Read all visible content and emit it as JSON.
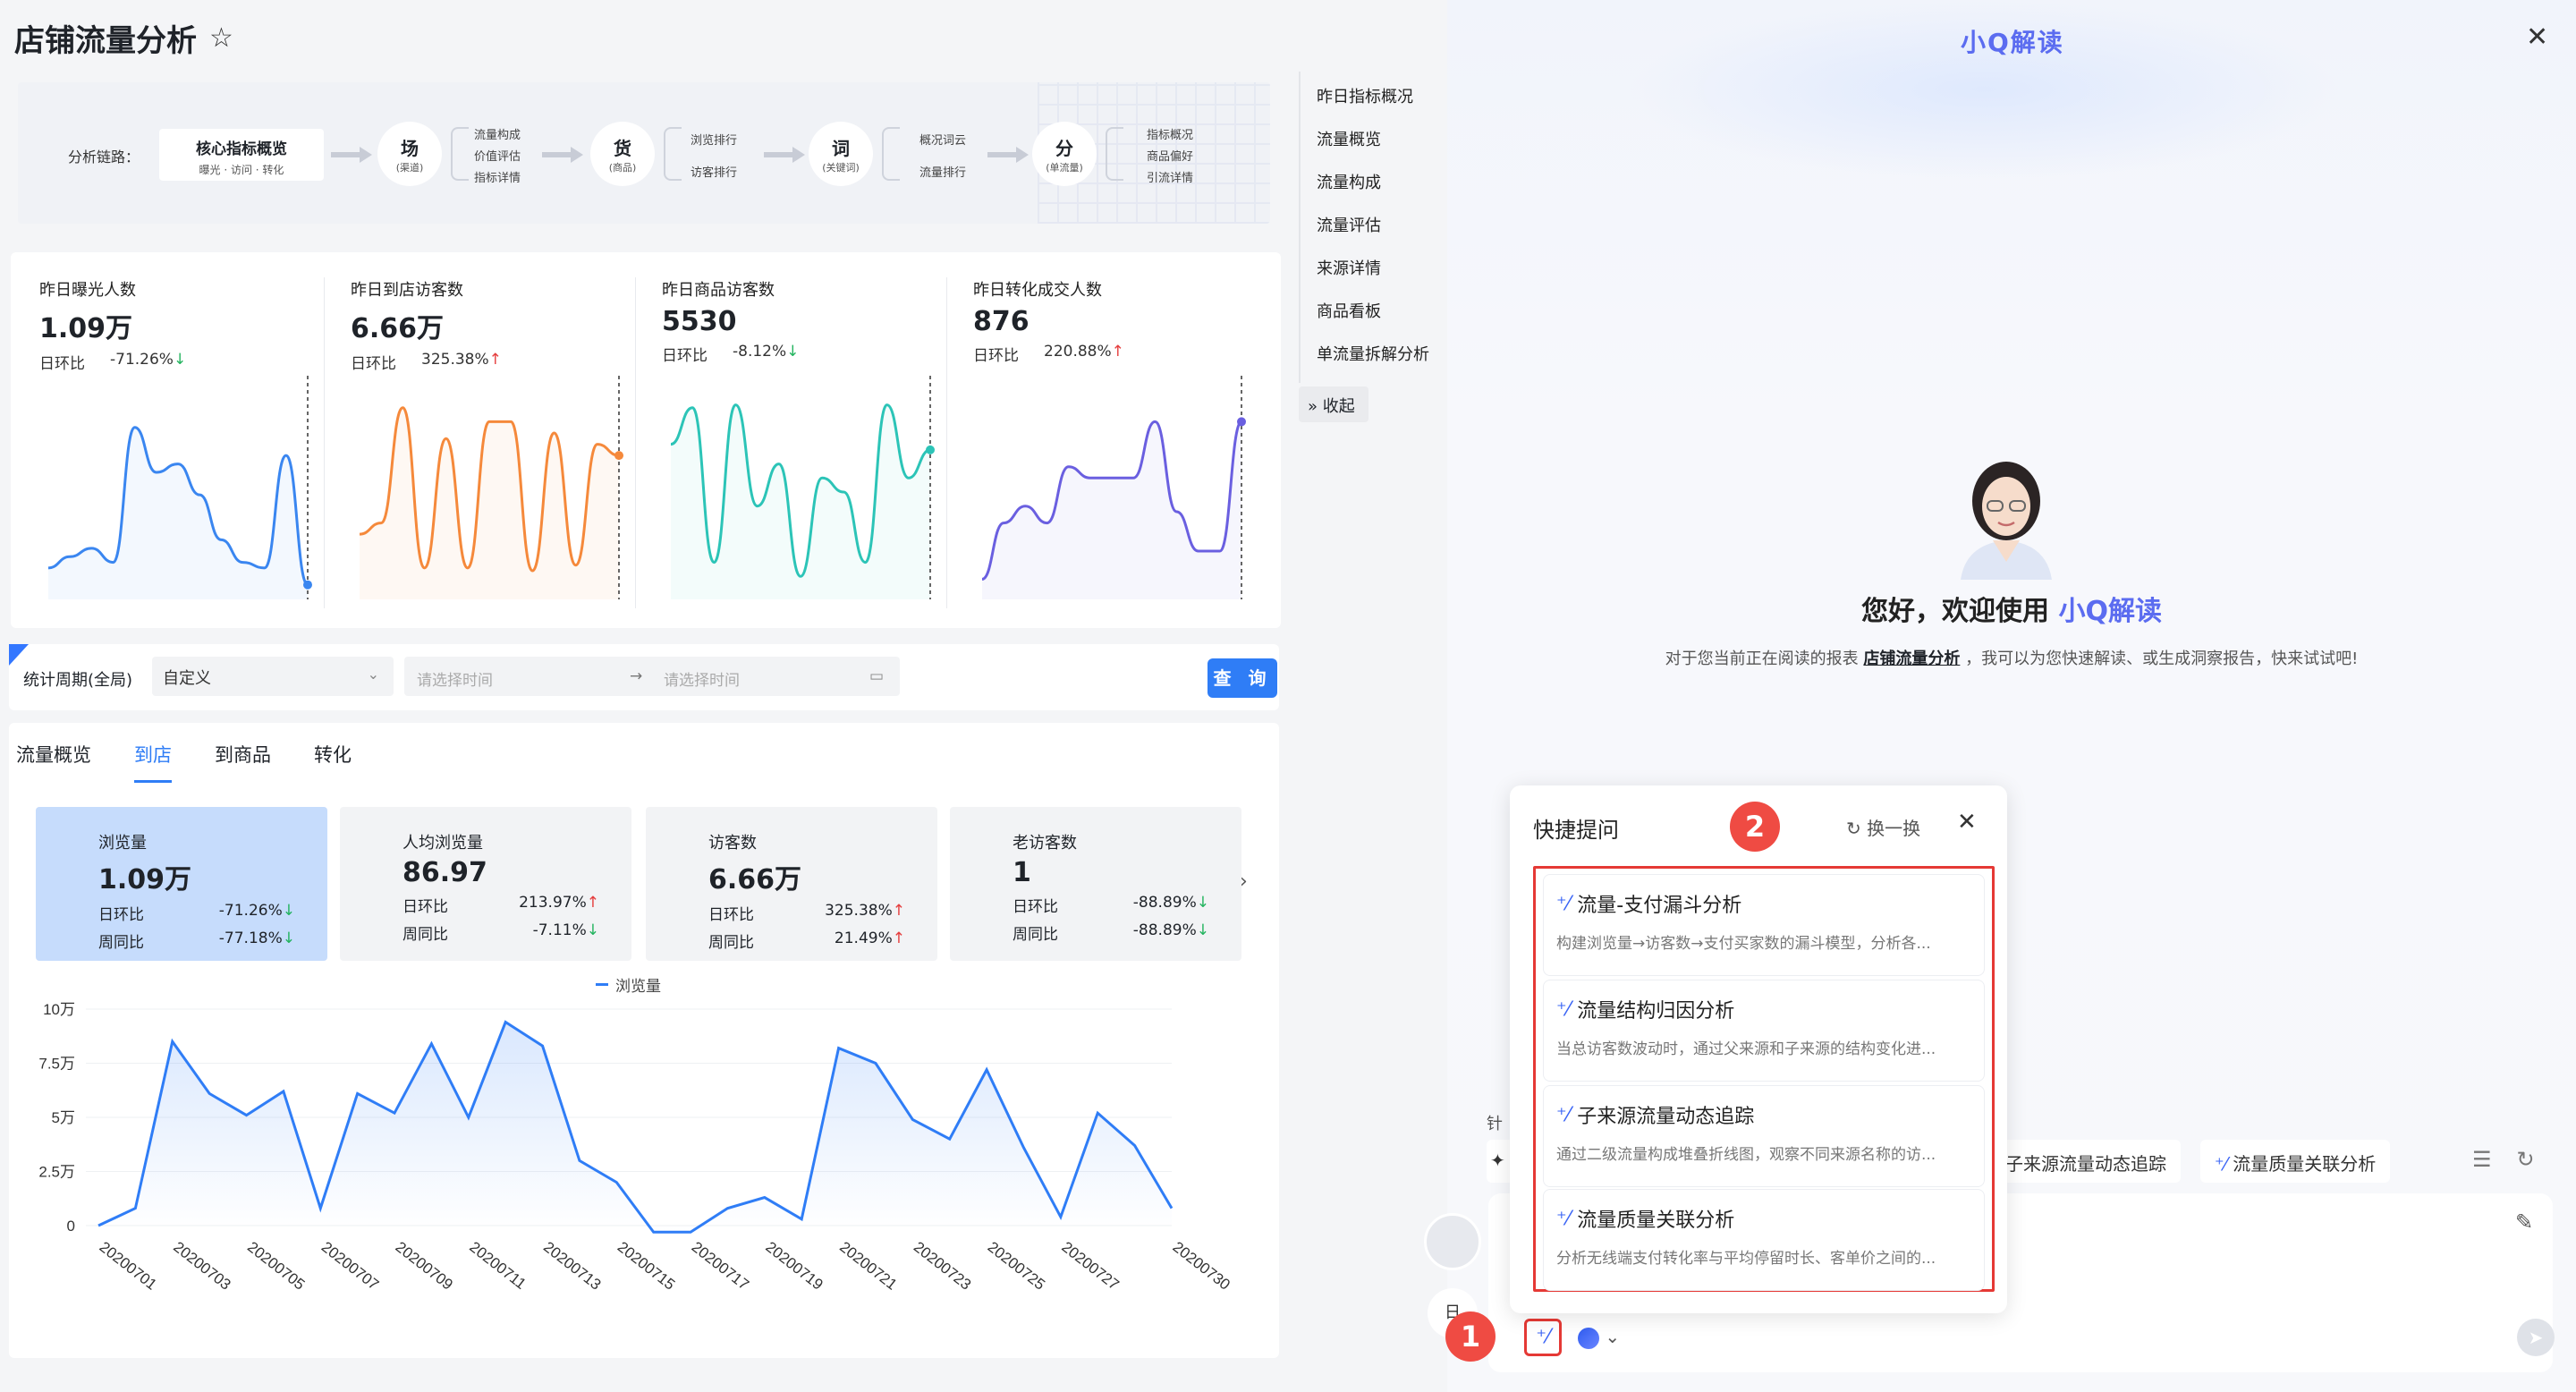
{
  "page": {
    "title": "店铺流量分析"
  },
  "chain": {
    "label": "分析链路：",
    "core_title": "核心指标概览",
    "core_sub": "曝光 · 访问 · 转化",
    "nodes": [
      {
        "title": "场",
        "sub": "(渠道)",
        "items": [
          "流量构成",
          "价值评估",
          "指标详情"
        ]
      },
      {
        "title": "货",
        "sub": "(商品)",
        "items": [
          "浏览排行",
          "访客排行"
        ]
      },
      {
        "title": "词",
        "sub": "(关键词)",
        "items": [
          "概况词云",
          "流量排行"
        ]
      },
      {
        "title": "分",
        "sub": "(单流量)",
        "items": [
          "指标概况",
          "商品偏好",
          "引流详情"
        ]
      }
    ]
  },
  "kpis": [
    {
      "label": "昨日曝光人数",
      "value": "1.09万",
      "cmp_label": "日环比",
      "cmp_value": "-71.26%",
      "dir": "down",
      "color": "#3a86f0",
      "series": [
        8,
        12,
        15,
        10,
        58,
        42,
        45,
        34,
        18,
        10,
        8,
        48,
        2
      ]
    },
    {
      "label": "昨日到店访客数",
      "value": "6.66万",
      "cmp_label": "日环比",
      "cmp_value": "325.38%",
      "dir": "up",
      "color": "#f5893b",
      "series": [
        20,
        24,
        65,
        8,
        54,
        8,
        60,
        60,
        7,
        56,
        9,
        52,
        48
      ]
    },
    {
      "label": "昨日商品访客数",
      "value": "5530",
      "cmp_label": "日环比",
      "cmp_value": "-8.12%",
      "dir": "down",
      "color": "#2cc4b7",
      "series": [
        52,
        65,
        10,
        66,
        30,
        45,
        5,
        40,
        35,
        10,
        66,
        40,
        50
      ]
    },
    {
      "label": "昨日转化成交人数",
      "value": "876",
      "cmp_label": "日环比",
      "cmp_value": "220.88%",
      "dir": "up",
      "color": "#6a5fe0",
      "series": [
        4,
        24,
        30,
        24,
        44,
        40,
        40,
        40,
        60,
        28,
        14,
        14,
        60
      ]
    }
  ],
  "filter": {
    "period_label": "统计周期(全局)",
    "mode": "自定义",
    "start_placeholder": "请选择时间",
    "end_placeholder": "请选择时间",
    "query": "查 询"
  },
  "detail": {
    "tabs": [
      "流量概览",
      "到店",
      "到商品",
      "转化"
    ],
    "active_tab": 1,
    "cards": [
      {
        "label": "浏览量",
        "value": "1.09万",
        "rows": [
          {
            "k": "日环比",
            "v": "-71.26%",
            "dir": "down"
          },
          {
            "k": "周同比",
            "v": "-77.18%",
            "dir": "down"
          }
        ]
      },
      {
        "label": "人均浏览量",
        "value": "86.97",
        "rows": [
          {
            "k": "日环比",
            "v": "213.97%",
            "dir": "up"
          },
          {
            "k": "周同比",
            "v": "-7.11%",
            "dir": "down"
          }
        ]
      },
      {
        "label": "访客数",
        "value": "6.66万",
        "rows": [
          {
            "k": "日环比",
            "v": "325.38%",
            "dir": "up"
          },
          {
            "k": "周同比",
            "v": "21.49%",
            "dir": "up"
          }
        ]
      },
      {
        "label": "老访客数",
        "value": "1",
        "rows": [
          {
            "k": "日环比",
            "v": "-88.89%",
            "dir": "down"
          },
          {
            "k": "周同比",
            "v": "-88.89%",
            "dir": "down"
          }
        ]
      }
    ]
  },
  "chart_data": {
    "type": "area",
    "legend": "浏览量",
    "ylim": [
      0,
      100000
    ],
    "yticks": [
      "0",
      "2.5万",
      "5万",
      "7.5万",
      "10万"
    ],
    "x": [
      "20200701",
      "20200702",
      "20200703",
      "20200704",
      "20200705",
      "20200706",
      "20200707",
      "20200708",
      "20200709",
      "20200710",
      "20200711",
      "20200712",
      "20200713",
      "20200714",
      "20200715",
      "20200716",
      "20200717",
      "20200718",
      "20200719",
      "20200720",
      "20200721",
      "20200722",
      "20200723",
      "20200724",
      "20200725",
      "20200726",
      "20200727",
      "20200728",
      "20200729",
      "20200730"
    ],
    "xticks_shown": [
      "20200701",
      "20200703",
      "20200705",
      "20200707",
      "20200709",
      "20200711",
      "20200713",
      "20200715",
      "20200717",
      "20200719",
      "20200721",
      "20200723",
      "20200725",
      "20200727",
      "20200730"
    ],
    "series": [
      {
        "name": "浏览量",
        "color": "#2f7df6",
        "values": [
          0,
          8000,
          85000,
          61000,
          51000,
          62000,
          8000,
          61000,
          52000,
          84000,
          50000,
          94000,
          83000,
          30000,
          20000,
          -3000,
          -3000,
          8000,
          13000,
          3000,
          82000,
          75000,
          49000,
          40000,
          72000,
          36000,
          4000,
          52000,
          37000,
          8000
        ]
      }
    ]
  },
  "anchor_nav": {
    "items": [
      "昨日指标概况",
      "流量概览",
      "流量构成",
      "流量评估",
      "来源详情",
      "商品看板",
      "单流量拆解分析"
    ],
    "collapse": "收起"
  },
  "assistant": {
    "brand": "小Q解读",
    "welcome_prefix": "您好，欢迎使用",
    "welcome_brand": "小Q解读",
    "sub_prefix": "对于您当前正在阅读的报表",
    "sub_link": "店铺流量分析",
    "sub_suffix": "，我可以为您快速解读、或生成洞察报告，快来试试吧!",
    "hint_prefix": "针",
    "chips": [
      "子来源流量动态追踪",
      "流量质量关联分析"
    ],
    "side_label": "日"
  },
  "quick_panel": {
    "title": "快捷提问",
    "refresh": "换一换",
    "items": [
      {
        "title": "流量-支付漏斗分析",
        "desc": "构建浏览量→访客数→支付买家数的漏斗模型，分析各..."
      },
      {
        "title": "流量结构归因分析",
        "desc": "当总访客数波动时，通过父来源和子来源的结构变化进..."
      },
      {
        "title": "子来源流量动态追踪",
        "desc": "通过二级流量构成堆叠折线图，观察不同来源名称的访..."
      },
      {
        "title": "流量质量关联分析",
        "desc": "分析无线端支付转化率与平均停留时长、客单价之间的..."
      }
    ]
  },
  "badges": {
    "one": "1",
    "two": "2"
  },
  "icons": {
    "star": "star-icon",
    "arrow": "arrow-right-icon",
    "calendar": "calendar-icon",
    "close": "close-icon",
    "refresh": "refresh-icon",
    "magic": "magic-wand-icon",
    "send": "send-icon",
    "edit": "edit-icon",
    "chevron": "chevron-right-icon"
  }
}
